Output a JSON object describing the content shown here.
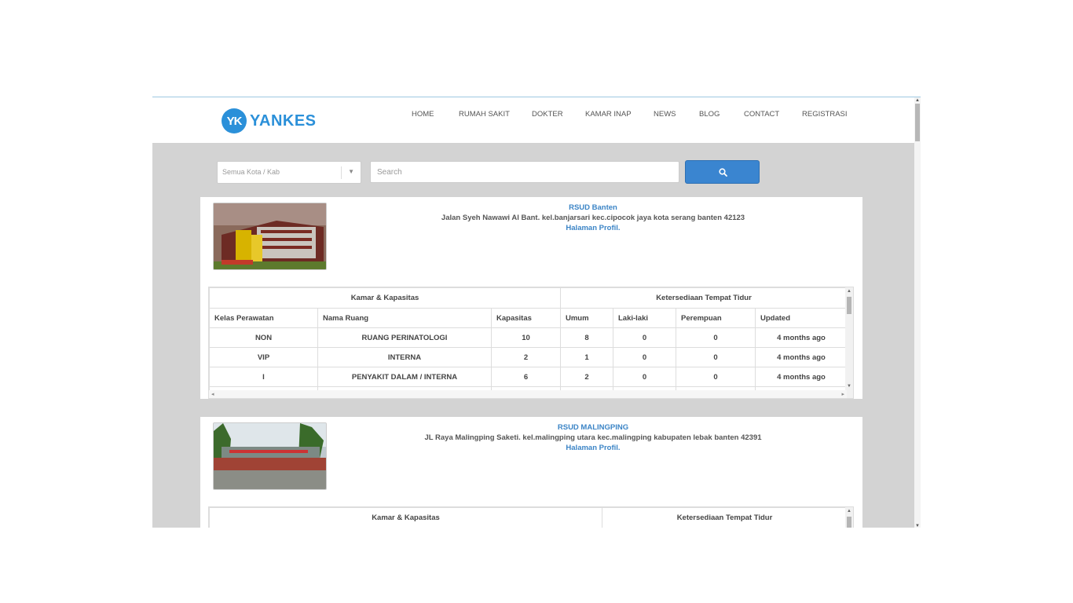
{
  "header": {
    "logo_badge": "YK",
    "logo_text": "YANKES",
    "nav": [
      "HOME",
      "RUMAH SAKIT",
      "DOKTER",
      "KAMAR INAP",
      "NEWS",
      "BLOG",
      "CONTACT",
      "REGISTRASI"
    ]
  },
  "search": {
    "city_select": "Semua Kota / Kab",
    "input_placeholder": "Search",
    "button_icon": "search-icon"
  },
  "hospitals": [
    {
      "name": "RSUD Banten",
      "address": "Jalan Syeh Nawawi Al Bant. kel.banjarsari kec.cipocok jaya kota serang banten 42123",
      "profile_link": "Halaman Profil.",
      "table": {
        "group_headers": [
          "Kamar & Kapasitas",
          "Ketersediaan Tempat Tidur"
        ],
        "columns": [
          "Kelas Perawatan",
          "Nama Ruang",
          "Kapasitas",
          "Umum",
          "Laki-laki",
          "Perempuan",
          "Updated"
        ],
        "rows": [
          [
            "NON",
            "RUANG PERINATOLOGI",
            "10",
            "8",
            "0",
            "0",
            "4 months ago"
          ],
          [
            "VIP",
            "INTERNA",
            "2",
            "1",
            "0",
            "0",
            "4 months ago"
          ],
          [
            "I",
            "PENYAKIT DALAM / INTERNA",
            "6",
            "2",
            "0",
            "0",
            "4 months ago"
          ]
        ]
      }
    },
    {
      "name": "RSUD MALINGPING",
      "address": "JL Raya Malingping Saketi. kel.malingping utara kec.malingping kabupaten lebak banten 42391",
      "profile_link": "Halaman Profil.",
      "table": {
        "group_headers": [
          "Kamar & Kapasitas",
          "Ketersediaan Tempat Tidur"
        ]
      }
    }
  ],
  "colors": {
    "brand": "#2b90d9",
    "link": "#3b84c6",
    "button": "#3a85d0",
    "page_bg": "#d3d3d3"
  }
}
